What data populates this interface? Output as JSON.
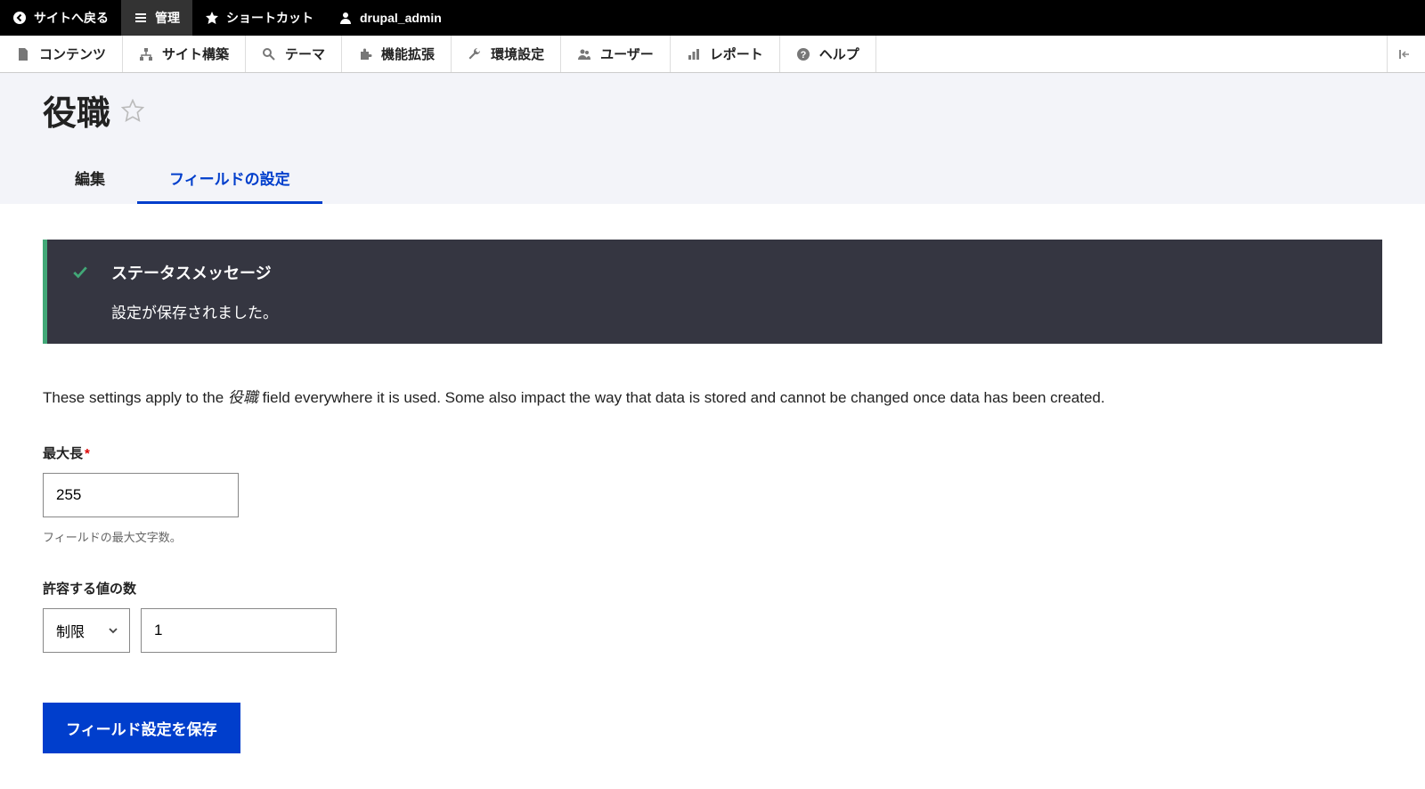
{
  "topbar": {
    "back_to_site": "サイトへ戻る",
    "manage": "管理",
    "shortcuts": "ショートカット",
    "user": "drupal_admin"
  },
  "adminmenu": {
    "content": "コンテンツ",
    "structure": "サイト構築",
    "appearance": "テーマ",
    "extend": "機能拡張",
    "configuration": "環境設定",
    "people": "ユーザー",
    "reports": "レポート",
    "help": "ヘルプ"
  },
  "page": {
    "title": "役職"
  },
  "tabs": {
    "edit": "編集",
    "field_settings": "フィールドの設定"
  },
  "status": {
    "title": "ステータスメッセージ",
    "body": "設定が保存されました。"
  },
  "description": {
    "pre": "These settings apply to the ",
    "em": "役職",
    "post": " field everywhere it is used. Some also impact the way that data is stored and cannot be changed once data has been created."
  },
  "form": {
    "max_length_label": "最大長",
    "max_length_value": "255",
    "max_length_help": "フィールドの最大文字数。",
    "allowed_values_label": "許容する値の数",
    "limit_select": "制限",
    "limit_value": "1",
    "submit": "フィールド設定を保存"
  }
}
